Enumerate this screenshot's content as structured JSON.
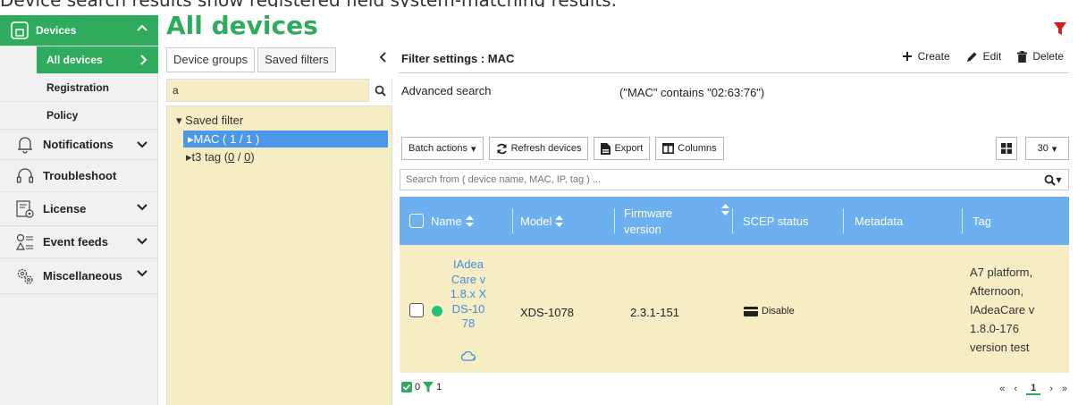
{
  "top_banner": "Device search results show registered field system-matching results.",
  "sidebar": {
    "items": [
      {
        "label": "Devices"
      },
      {
        "label": "All devices"
      },
      {
        "label": "Registration"
      },
      {
        "label": "Policy"
      },
      {
        "label": "Notifications"
      },
      {
        "label": "Troubleshoot"
      },
      {
        "label": "License"
      },
      {
        "label": "Event feeds"
      },
      {
        "label": "Miscellaneous"
      }
    ]
  },
  "page": {
    "title": "All devices"
  },
  "left_panel": {
    "tabs": [
      {
        "label": "Device groups"
      },
      {
        "label": "Saved filters"
      }
    ],
    "search_value": "a",
    "tree": {
      "root": "Saved filter",
      "items": [
        {
          "name": "MAC",
          "count": "( 1 / 1 )"
        },
        {
          "name": "t3 tag",
          "count_open": "(",
          "count_a": "0",
          "count_sep": " / ",
          "count_b": "0",
          "count_close": ")"
        }
      ]
    }
  },
  "filter": {
    "title": "Filter settings : MAC",
    "actions": {
      "create": "Create",
      "edit": "Edit",
      "delete": "Delete"
    },
    "advanced_label": "Advanced search",
    "advanced_value": "(\"MAC\" contains \"02:63:76\")"
  },
  "toolbar": {
    "batch": "Batch actions",
    "refresh": "Refresh devices",
    "export": "Export",
    "columns": "Columns",
    "per_page": "30"
  },
  "search": {
    "placeholder": "Search from ( device name, MAC, IP, tag ) ..."
  },
  "table": {
    "headers": {
      "name": "Name",
      "model": "Model",
      "firmware": "Firmware version",
      "scep": "SCEP status",
      "metadata": "Metadata",
      "tag": "Tag"
    },
    "rows": [
      {
        "name": "IAdeaCare v1.8.x XDS-1078",
        "model": "XDS-1078",
        "firmware": "2.3.1-151",
        "scep": "Disable",
        "metadata": "",
        "tag": "A7 platform, Afternoon, IAdeaCare v 1.8.0-176 version test"
      }
    ]
  },
  "footer": {
    "checked_count": "0",
    "filter_count": "1",
    "pager": {
      "first": "«",
      "prev": "‹",
      "current": "1",
      "next": "›",
      "last": "»"
    }
  },
  "colors": {
    "accent_green": "#2eab5c",
    "header_blue": "#6db0f0",
    "row_highlight": "#f6edc4",
    "status_green": "#1fc37a",
    "filter_red": "#d81b1b"
  }
}
